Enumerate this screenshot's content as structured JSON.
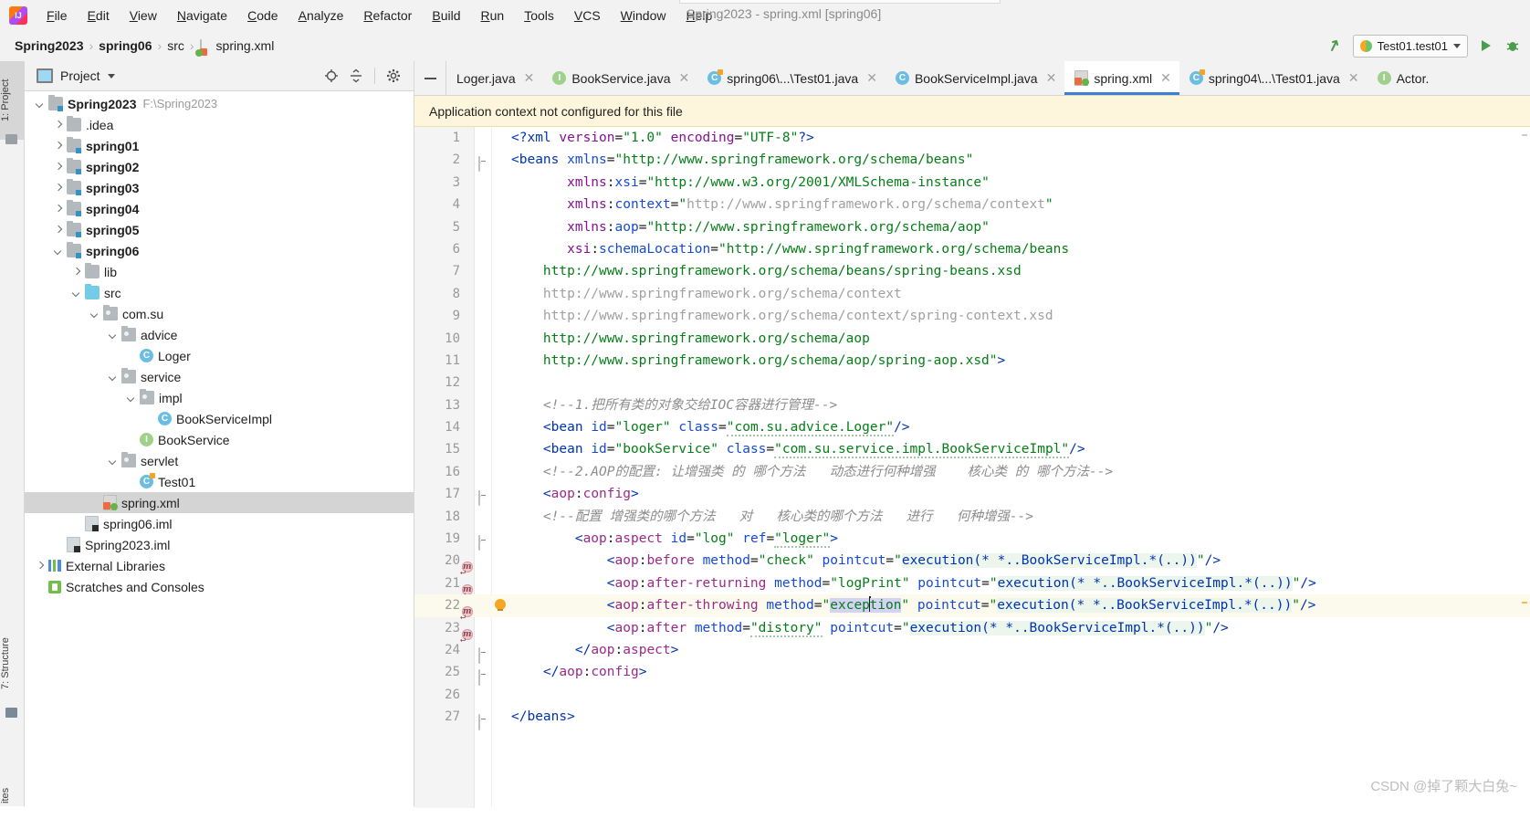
{
  "window": {
    "title": "Spring2023 - spring.xml [spring06]"
  },
  "menu": {
    "items": [
      "File",
      "Edit",
      "View",
      "Navigate",
      "Code",
      "Analyze",
      "Refactor",
      "Build",
      "Run",
      "Tools",
      "VCS",
      "Window",
      "Help"
    ]
  },
  "breadcrumb": {
    "items": [
      "Spring2023",
      "spring06",
      "src",
      "spring.xml"
    ],
    "separator": "›"
  },
  "toolbar": {
    "run_config": "Test01.test01",
    "back_icon": "back-arrow-icon",
    "run_icon": "run-icon",
    "debug_icon": "debug-icon"
  },
  "stripe": {
    "project": "1: Project",
    "structure": "7: Structure",
    "favorites": "ites"
  },
  "project_panel": {
    "title": "Project",
    "locate_icon": "locate-target-icon",
    "collapse_icon": "collapse-all-icon",
    "settings_icon": "gear-icon",
    "tree": [
      {
        "indent": 0,
        "arrow": "open",
        "icon": "folder-module",
        "label": "Spring2023",
        "bold": true,
        "path": "F:\\Spring2023"
      },
      {
        "indent": 1,
        "arrow": "closed",
        "icon": "folder",
        "label": ".idea",
        "bold": false,
        "path": ""
      },
      {
        "indent": 1,
        "arrow": "closed",
        "icon": "folder-module",
        "label": "spring01",
        "bold": true,
        "path": ""
      },
      {
        "indent": 1,
        "arrow": "closed",
        "icon": "folder-module",
        "label": "spring02",
        "bold": true,
        "path": ""
      },
      {
        "indent": 1,
        "arrow": "closed",
        "icon": "folder-module",
        "label": "spring03",
        "bold": true,
        "path": ""
      },
      {
        "indent": 1,
        "arrow": "closed",
        "icon": "folder-module",
        "label": "spring04",
        "bold": true,
        "path": ""
      },
      {
        "indent": 1,
        "arrow": "closed",
        "icon": "folder-module",
        "label": "spring05",
        "bold": true,
        "path": ""
      },
      {
        "indent": 1,
        "arrow": "open",
        "icon": "folder-module",
        "label": "spring06",
        "bold": true,
        "path": ""
      },
      {
        "indent": 2,
        "arrow": "closed",
        "icon": "folder",
        "label": "lib",
        "bold": false,
        "path": ""
      },
      {
        "indent": 2,
        "arrow": "open",
        "icon": "folder-src",
        "label": "src",
        "bold": false,
        "path": ""
      },
      {
        "indent": 3,
        "arrow": "open",
        "icon": "package",
        "label": "com.su",
        "bold": false,
        "path": ""
      },
      {
        "indent": 4,
        "arrow": "open",
        "icon": "package",
        "label": "advice",
        "bold": false,
        "path": ""
      },
      {
        "indent": 5,
        "arrow": "none",
        "icon": "class",
        "label": "Loger",
        "bold": false,
        "path": ""
      },
      {
        "indent": 4,
        "arrow": "open",
        "icon": "package",
        "label": "service",
        "bold": false,
        "path": ""
      },
      {
        "indent": 5,
        "arrow": "open",
        "icon": "package",
        "label": "impl",
        "bold": false,
        "path": ""
      },
      {
        "indent": 6,
        "arrow": "none",
        "icon": "class",
        "label": "BookServiceImpl",
        "bold": false,
        "path": ""
      },
      {
        "indent": 5,
        "arrow": "none",
        "icon": "interface",
        "label": "BookService",
        "bold": false,
        "path": ""
      },
      {
        "indent": 4,
        "arrow": "open",
        "icon": "package",
        "label": "servlet",
        "bold": false,
        "path": ""
      },
      {
        "indent": 5,
        "arrow": "none",
        "icon": "class-runnable",
        "label": "Test01",
        "bold": false,
        "path": ""
      },
      {
        "indent": 3,
        "arrow": "none",
        "icon": "xml",
        "label": "spring.xml",
        "bold": false,
        "path": "",
        "selected": true
      },
      {
        "indent": 2,
        "arrow": "none",
        "icon": "iml",
        "label": "spring06.iml",
        "bold": false,
        "path": ""
      },
      {
        "indent": 1,
        "arrow": "none",
        "icon": "iml",
        "label": "Spring2023.iml",
        "bold": false,
        "path": ""
      },
      {
        "indent": 0,
        "arrow": "closed",
        "icon": "library",
        "label": "External Libraries",
        "bold": false,
        "path": ""
      },
      {
        "indent": 0,
        "arrow": "none",
        "icon": "scratch",
        "label": "Scratches and Consoles",
        "bold": false,
        "path": ""
      }
    ]
  },
  "editor": {
    "tabs": [
      {
        "icon": "none",
        "label": "Loger.java",
        "active": false
      },
      {
        "icon": "interface",
        "label": "BookService.java",
        "active": false
      },
      {
        "icon": "class-runnable",
        "label": "spring06\\...\\Test01.java",
        "active": false
      },
      {
        "icon": "class",
        "label": "BookServiceImpl.java",
        "active": false
      },
      {
        "icon": "xml",
        "label": "spring.xml",
        "active": true
      },
      {
        "icon": "class-runnable",
        "label": "spring04\\...\\Test01.java",
        "active": false
      },
      {
        "icon": "interface",
        "label": "Actor.",
        "active": false
      }
    ],
    "close_glyph": "✕",
    "notice": "Application context not configured for this file",
    "total_lines": 27
  },
  "code_lines": [
    {
      "n": 1,
      "text": "<?xml version=\"1.0\" encoding=\"UTF-8\"?>"
    },
    {
      "n": 2,
      "text": "<beans xmlns=\"http://www.springframework.org/schema/beans\"",
      "fold": "tip"
    },
    {
      "n": 3,
      "text": "       xmlns:xsi=\"http://www.w3.org/2001/XMLSchema-instance\""
    },
    {
      "n": 4,
      "text": "       xmlns:context=\"http://www.springframework.org/schema/context\""
    },
    {
      "n": 5,
      "text": "       xmlns:aop=\"http://www.springframework.org/schema/aop\""
    },
    {
      "n": 6,
      "text": "       xsi:schemaLocation=\"http://www.springframework.org/schema/beans"
    },
    {
      "n": 7,
      "text": "    http://www.springframework.org/schema/beans/spring-beans.xsd"
    },
    {
      "n": 8,
      "text": "    http://www.springframework.org/schema/context"
    },
    {
      "n": 9,
      "text": "    http://www.springframework.org/schema/context/spring-context.xsd"
    },
    {
      "n": 10,
      "text": "    http://www.springframework.org/schema/aop"
    },
    {
      "n": 11,
      "text": "    http://www.springframework.org/schema/aop/spring-aop.xsd\">"
    },
    {
      "n": 12,
      "text": ""
    },
    {
      "n": 13,
      "text": "    <!--1.把所有类的对象交给IOC容器进行管理-->"
    },
    {
      "n": 14,
      "text": "    <bean id=\"loger\" class=\"com.su.advice.Loger\"/>"
    },
    {
      "n": 15,
      "text": "    <bean id=\"bookService\" class=\"com.su.service.impl.BookServiceImpl\"/>"
    },
    {
      "n": 16,
      "text": "    <!--2.AOP的配置: 让增强类 的 哪个方法   动态进行何种增强    核心类 的 哪个方法-->"
    },
    {
      "n": 17,
      "text": "    <aop:config>",
      "fold": "tip"
    },
    {
      "n": 18,
      "text": "    <!--配置 增强类的哪个方法   对   核心类的哪个方法   进行   何种增强-->"
    },
    {
      "n": 19,
      "text": "        <aop:aspect id=\"log\" ref=\"loger\">",
      "fold": "tip"
    },
    {
      "n": 20,
      "text": "            <aop:before method=\"check\" pointcut=\"execution(* *..BookServiceImpl.*(..))\"/>",
      "gutter": "method"
    },
    {
      "n": 21,
      "text": "            <aop:after-returning method=\"logPrint\" pointcut=\"execution(* *..BookServiceImpl.*(..))\"/>",
      "gutter": "method"
    },
    {
      "n": 22,
      "text": "            <aop:after-throwing method=\"exception\" pointcut=\"execution(* *..BookServiceImpl.*(..))\"/>",
      "gutter": "method",
      "bulb": true,
      "highlight": true
    },
    {
      "n": 23,
      "text": "            <aop:after method=\"distory\" pointcut=\"execution(* *..BookServiceImpl.*(..))\"/>",
      "gutter": "method"
    },
    {
      "n": 24,
      "text": "        </aop:aspect>",
      "fold": "end"
    },
    {
      "n": 25,
      "text": "    </aop:config>",
      "fold": "end"
    },
    {
      "n": 26,
      "text": ""
    },
    {
      "n": 27,
      "text": "</beans>",
      "fold": "end"
    }
  ],
  "watermark": "CSDN @掉了颗大白兔~",
  "colors": {
    "tag": "#0033b3",
    "namespace": "#871094",
    "attribute": "#174ad4",
    "value": "#067d17",
    "comment": "#8c8c8c",
    "aop_tag": "#9a2a8a",
    "accent": "#3c7fd0",
    "notice_bg": "#fdf6dd",
    "selection": "#d4d2f5",
    "pointcut_highlight": "#ecf6ec"
  }
}
